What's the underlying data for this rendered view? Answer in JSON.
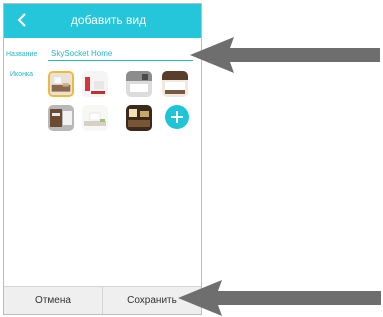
{
  "header": {
    "title": "добавить вид",
    "back_icon": "chevron-left-icon"
  },
  "form": {
    "name_label": "Название",
    "name_value": "SkySocket Home",
    "icon_label": "Иконка"
  },
  "icons": [
    {
      "name": "living-room-thumb",
      "selected": true
    },
    {
      "name": "red-room-thumb",
      "selected": false
    },
    {
      "name": "bathroom-thumb",
      "selected": false
    },
    {
      "name": "bedroom-thumb",
      "selected": false
    },
    {
      "name": "kitchen-thumb",
      "selected": false
    },
    {
      "name": "bright-room-thumb",
      "selected": false
    },
    {
      "name": "dining-room-thumb",
      "selected": false
    }
  ],
  "add_icon": "plus-icon",
  "footer": {
    "cancel_label": "Отмена",
    "save_label": "Сохранить"
  },
  "colors": {
    "accent": "#26c6da",
    "selected_border": "#f0b83c",
    "arrow": "#6e6e6e"
  }
}
